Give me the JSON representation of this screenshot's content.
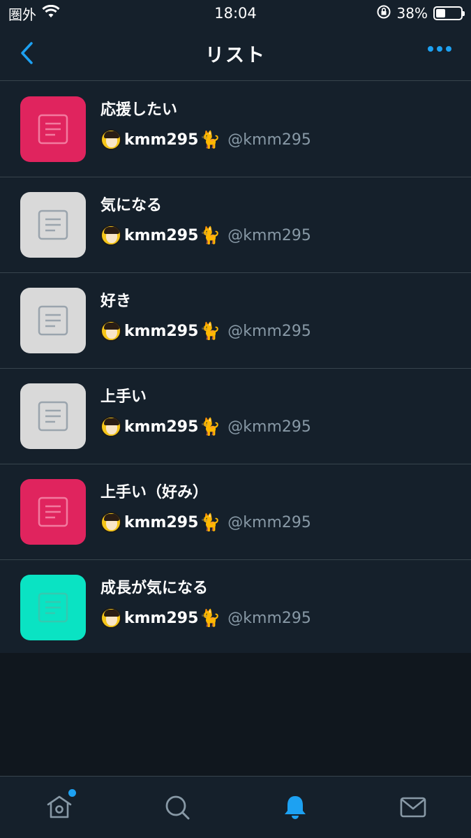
{
  "status_bar": {
    "carrier": "圏外",
    "time": "18:04",
    "battery": "38%",
    "battery_level": 0.38
  },
  "header": {
    "title": "リスト"
  },
  "lists": [
    {
      "name": "応援したい",
      "owner_name": "kmm295",
      "owner_handle": "@kmm295",
      "color": "#e0245e"
    },
    {
      "name": "気になる",
      "owner_name": "kmm295",
      "owner_handle": "@kmm295",
      "color": "#d9d9d9"
    },
    {
      "name": "好き",
      "owner_name": "kmm295",
      "owner_handle": "@kmm295",
      "color": "#d9d9d9"
    },
    {
      "name": "上手い",
      "owner_name": "kmm295",
      "owner_handle": "@kmm295",
      "color": "#d9d9d9"
    },
    {
      "name": "上手い（好み）",
      "owner_name": "kmm295",
      "owner_handle": "@kmm295",
      "color": "#e0245e"
    },
    {
      "name": "成長が気になる",
      "owner_name": "kmm295",
      "owner_handle": "@kmm295",
      "color": "#0ae3c3"
    }
  ],
  "tab_bar": {
    "tabs": [
      {
        "icon": "home-icon",
        "active": false,
        "has_badge": true
      },
      {
        "icon": "search-icon",
        "active": false,
        "has_badge": false
      },
      {
        "icon": "bell-icon",
        "active": true,
        "has_badge": false
      },
      {
        "icon": "mail-icon",
        "active": false,
        "has_badge": false
      }
    ]
  },
  "colors": {
    "accent": "#1da1f2",
    "background": "#15202b",
    "secondary_text": "#8899a6"
  }
}
